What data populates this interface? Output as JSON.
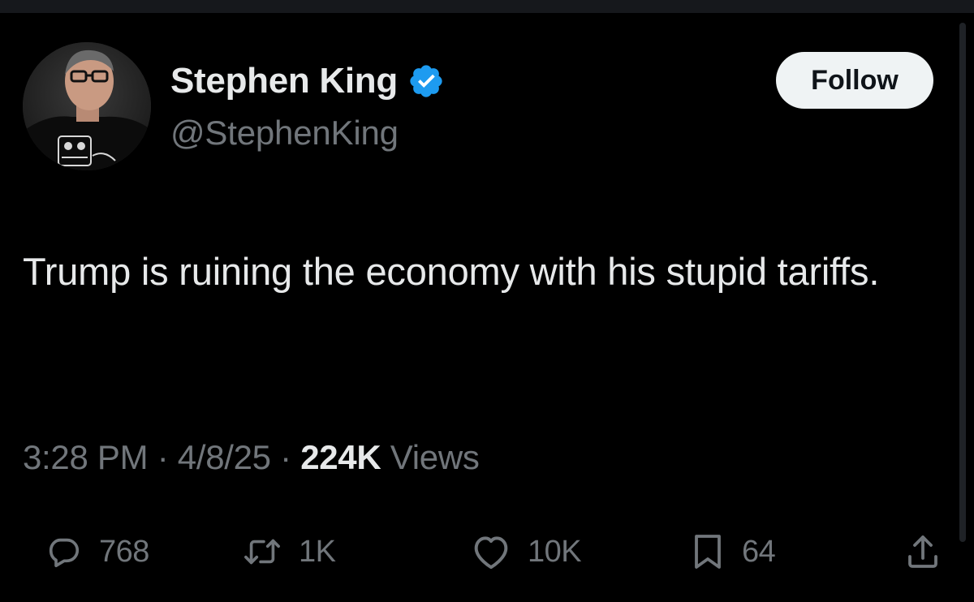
{
  "author": {
    "display_name": "Stephen King",
    "handle": "@StephenKing",
    "verified": true
  },
  "follow_button": {
    "label": "Follow"
  },
  "tweet": {
    "text": "Trump is ruining the economy with his stupid tariffs.",
    "time": "3:28 PM",
    "date": "4/8/25",
    "separator": "·",
    "views_count": "224K",
    "views_label": "Views"
  },
  "actions": {
    "replies": "768",
    "reposts": "1K",
    "likes": "10K",
    "bookmarks": "64"
  },
  "colors": {
    "background": "#000000",
    "primary_text": "#e7e9ea",
    "secondary_text": "#71767b",
    "verified_blue": "#1d9bf0",
    "follow_bg": "#eff3f4"
  },
  "icons": {
    "reply": "reply-bubble-icon",
    "repost": "repost-arrows-icon",
    "like": "heart-icon",
    "bookmark": "bookmark-icon",
    "share": "share-upload-icon",
    "verified": "verified-badge-icon"
  }
}
